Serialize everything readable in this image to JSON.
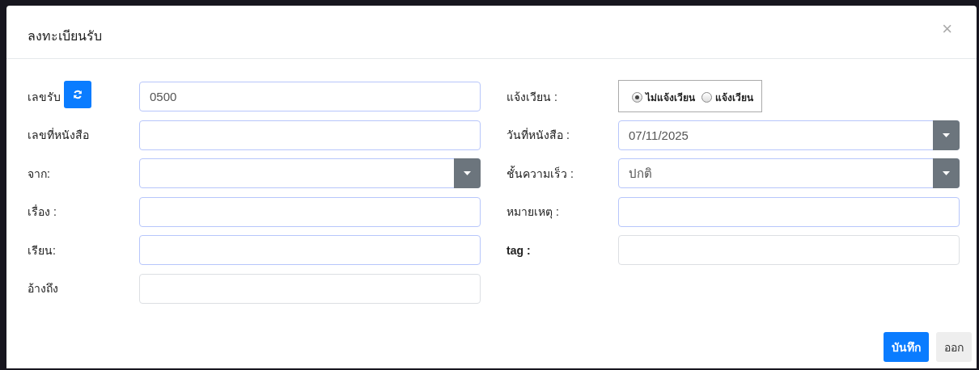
{
  "dialog": {
    "title": "ลงทะเบียนรับ",
    "close": "×"
  },
  "left_fields": [
    {
      "label": "เลขรับ",
      "kind": "refresh",
      "value": "0500",
      "highlighted": true
    },
    {
      "label": "เลขที่หนังสือ",
      "kind": "text",
      "highlighted": true
    },
    {
      "label": "จาก:",
      "kind": "select",
      "highlighted": true
    },
    {
      "label": "เรื่อง :",
      "kind": "text",
      "highlighted": true
    },
    {
      "label": "เรียน:",
      "kind": "text",
      "highlighted": true
    },
    {
      "label": "อ้างถึง",
      "kind": "text",
      "highlighted": false
    }
  ],
  "right_fields": [
    {
      "label": "แจ้งเวียน :",
      "kind": "radio",
      "options": [
        {
          "label": "ไม่แจ้งเวียน",
          "selected": true
        },
        {
          "label": "แจ้งเวียน",
          "selected": false
        }
      ]
    },
    {
      "label": "วันที่หนังสือ :",
      "kind": "select",
      "value": "07/11/2025",
      "highlighted": true
    },
    {
      "label": "ชั้นความเร็ว :",
      "kind": "select",
      "value": "ปกติ",
      "highlighted": true
    },
    {
      "label": "หมายเหตุ :",
      "kind": "text",
      "highlighted": true
    },
    {
      "label": "tag :",
      "kind": "text",
      "highlighted": false
    }
  ],
  "buttons": [
    {
      "label": "บันทึก",
      "kind": "primary"
    },
    {
      "label": "ออก",
      "kind": "secondary"
    }
  ]
}
